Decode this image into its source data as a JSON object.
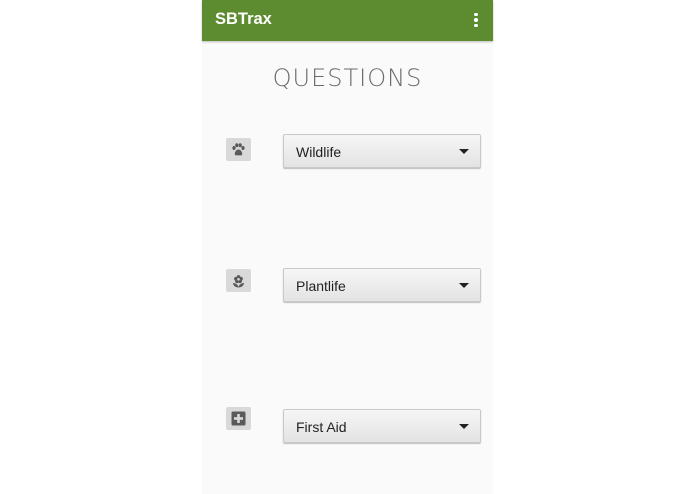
{
  "app": {
    "title": "SBTrax",
    "bar_color": "#5d8b2f"
  },
  "page": {
    "heading": "QUESTIONS"
  },
  "questions": [
    {
      "icon": "paw-icon",
      "selected": "Wildlife"
    },
    {
      "icon": "flower-icon",
      "selected": "Plantlife"
    },
    {
      "icon": "first-aid-icon",
      "selected": "First Aid"
    }
  ]
}
